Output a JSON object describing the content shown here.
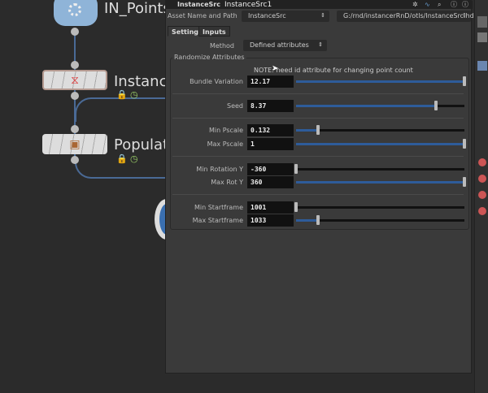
{
  "network": {
    "nodes": [
      {
        "label": "IN_Points"
      },
      {
        "label": "Instance"
      },
      {
        "label": "Populate"
      }
    ]
  },
  "panel": {
    "node_type": "InstanceSrc",
    "node_name": "InstanceSrc1",
    "asset_label": "Asset Name and Path",
    "asset_name": "InstanceSrc",
    "asset_path": "G:/rnd/instancerRnD/otls/InstanceSrc.hda",
    "tabs": [
      {
        "label": "Settings"
      },
      {
        "label": "Inputs"
      }
    ],
    "method_label": "Method",
    "method_value": "Defined attributes",
    "group_label": "Randomize Attributes",
    "note": "NOTE: need id attribute for changing point count",
    "params": [
      {
        "label": "Bundle Variation",
        "value": "12.17",
        "fraction": 1.0
      },
      {
        "label": "Seed",
        "value": "8.37",
        "fraction": 0.83
      },
      {
        "label": "Min Pscale",
        "value": "0.132",
        "fraction": 0.13
      },
      {
        "label": "Max Pscale",
        "value": "1",
        "fraction": 1.0
      },
      {
        "label": "Min Rotation Y",
        "value": "-360",
        "fraction": 0.0
      },
      {
        "label": "Max Rot Y",
        "value": "360",
        "fraction": 1.0
      },
      {
        "label": "Min Startframe",
        "value": "1001",
        "fraction": 0.0
      },
      {
        "label": "Max Startframe",
        "value": "1033",
        "fraction": 0.13
      }
    ]
  }
}
